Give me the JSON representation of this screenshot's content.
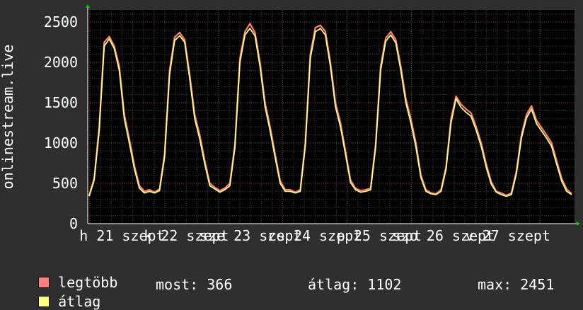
{
  "chart_data": {
    "type": "line",
    "ylabel": "onlinestream.live",
    "y_ticks": [
      0,
      500,
      1000,
      1500,
      2000,
      2500
    ],
    "ylim": [
      0,
      2650
    ],
    "x_tick_labels": [
      "h 21 szept",
      "k 22 szept",
      "sze 23 szept",
      "cs 24 szept",
      "p 25 szept",
      "szo 26 szept",
      "v 27 szept"
    ],
    "grid": true,
    "legend_position": "bottom-left",
    "series": [
      {
        "name": "legtöbb",
        "color": "#ff7f7f",
        "values": [
          350,
          560,
          1200,
          2250,
          2320,
          2200,
          1950,
          1350,
          1050,
          720,
          470,
          400,
          420,
          390,
          430,
          860,
          1900,
          2310,
          2370,
          2280,
          1850,
          1350,
          1100,
          780,
          500,
          450,
          410,
          440,
          500,
          980,
          2050,
          2380,
          2480,
          2370,
          2000,
          1500,
          1200,
          860,
          530,
          420,
          420,
          390,
          420,
          1000,
          2100,
          2430,
          2460,
          2380,
          2000,
          1500,
          1250,
          900,
          540,
          440,
          410,
          420,
          440,
          980,
          1950,
          2300,
          2380,
          2280,
          1950,
          1550,
          1300,
          1000,
          600,
          420,
          380,
          370,
          420,
          700,
          1300,
          1580,
          1480,
          1420,
          1370,
          1200,
          1000,
          740,
          520,
          400,
          380,
          350,
          380,
          650,
          1100,
          1350,
          1460,
          1280,
          1190,
          1100,
          1000,
          780,
          560,
          430,
          370
        ]
      },
      {
        "name": "átlag",
        "color": "#ffff80",
        "values": [
          340,
          540,
          1150,
          2200,
          2290,
          2170,
          1900,
          1300,
          1000,
          680,
          440,
          380,
          400,
          380,
          410,
          820,
          1850,
          2270,
          2330,
          2250,
          1800,
          1300,
          1050,
          740,
          470,
          430,
          390,
          420,
          470,
          940,
          2000,
          2340,
          2420,
          2330,
          1950,
          1450,
          1150,
          820,
          500,
          400,
          400,
          380,
          400,
          960,
          2050,
          2380,
          2420,
          2340,
          1950,
          1450,
          1200,
          860,
          510,
          420,
          390,
          400,
          420,
          940,
          1900,
          2260,
          2340,
          2240,
          1900,
          1500,
          1250,
          950,
          570,
          400,
          370,
          360,
          400,
          670,
          1250,
          1550,
          1440,
          1380,
          1330,
          1160,
          960,
          700,
          490,
          390,
          360,
          340,
          360,
          620,
          1060,
          1310,
          1420,
          1240,
          1150,
          1060,
          960,
          740,
          530,
          400,
          360
        ]
      }
    ]
  },
  "legend": [
    {
      "label": "legtöbb",
      "color": "#ff7f7f"
    },
    {
      "label": "átlag",
      "color": "#ffff80"
    }
  ],
  "stats": {
    "most": "most: 366",
    "atlag": "átlag: 1102",
    "max": "max: 2451"
  }
}
